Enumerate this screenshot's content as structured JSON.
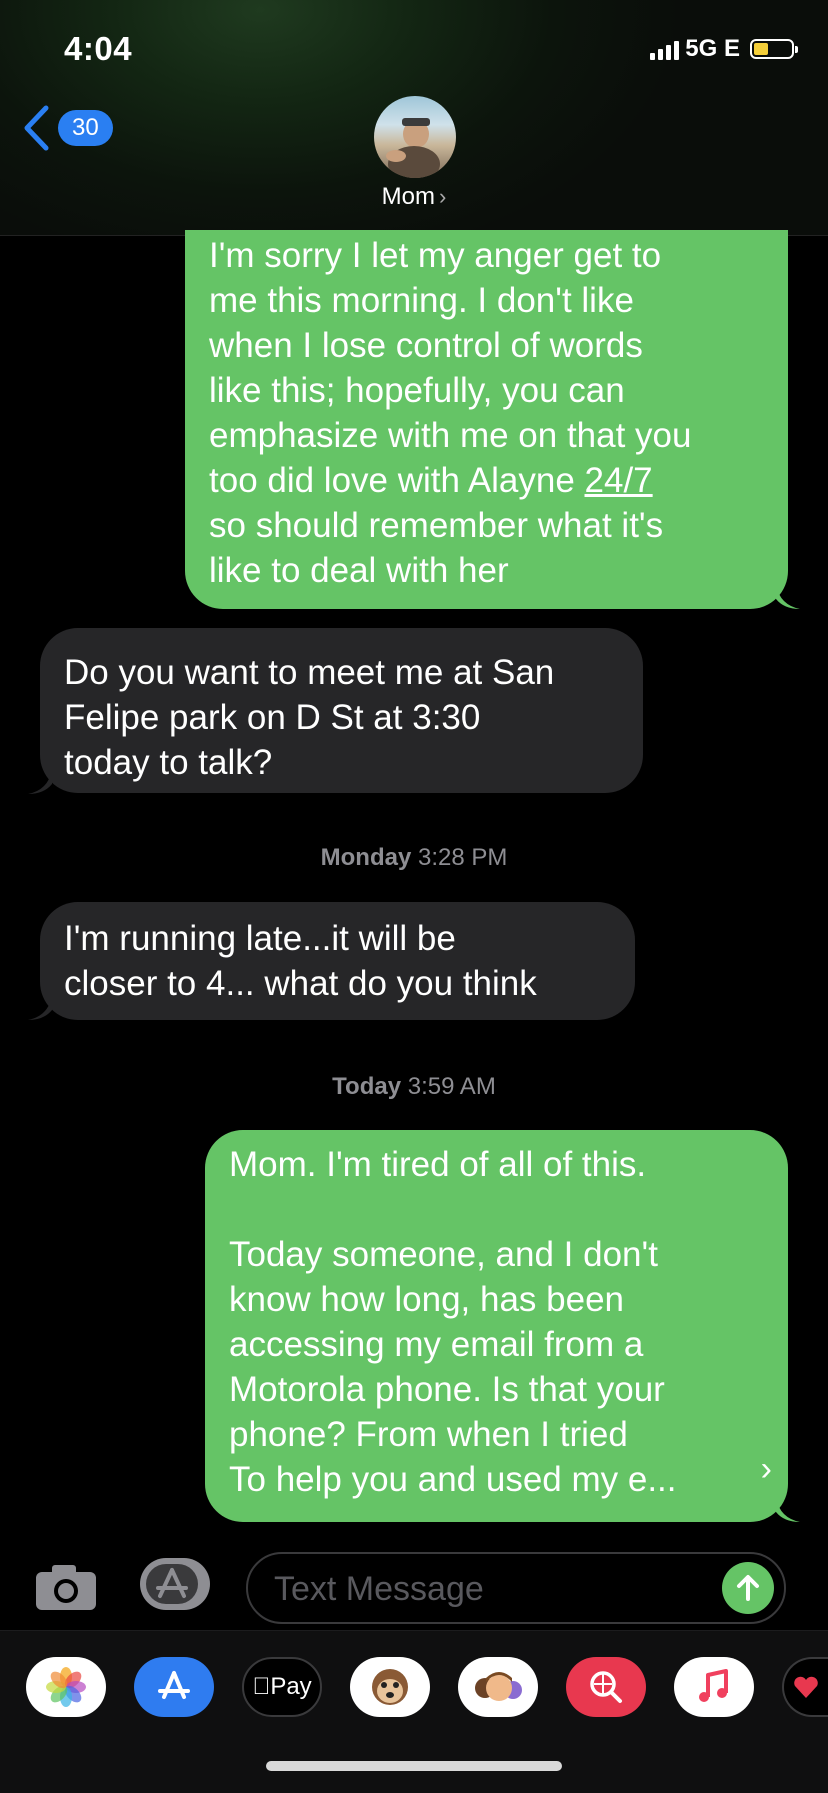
{
  "status_bar": {
    "time": "4:04",
    "network": "5G E"
  },
  "header": {
    "back_count": "30",
    "contact_name": "Mom"
  },
  "messages": [
    {
      "type": "sent",
      "text": "I'm sorry I let my anger get to\nme this morning. I don't like\nwhen I lose control of words\nlike this; hopefully, you can\nemphasize with me on that you\ntoo did love with Alayne ",
      "link": "24/7",
      "text_after": "\nso should remember what it's\nlike to deal with her"
    },
    {
      "type": "received",
      "text": "Do you want to meet me at San\nFelipe park on D St at 3:30\ntoday to talk?"
    },
    {
      "type": "received",
      "text": "I'm running late...it will be\ncloser to 4... what do you think"
    },
    {
      "type": "sent",
      "text": "Mom. I'm tired of all of this.\n\nToday someone, and I don't\nknow how long, has been\naccessing my email from a\nMotorola phone. Is that your\nphone? From when I tried\nTo help you and used my e..."
    }
  ],
  "timestamps": [
    {
      "day": "Monday",
      "time": "3:28 PM"
    },
    {
      "day": "Today",
      "time": "3:59 AM"
    }
  ],
  "input": {
    "placeholder": "Text Message"
  },
  "app_drawer": [
    {
      "name": "photos-icon"
    },
    {
      "name": "app-store-icon"
    },
    {
      "name": "apple-pay-icon",
      "label": "Pay"
    },
    {
      "name": "animoji-icon"
    },
    {
      "name": "memoji-icon"
    },
    {
      "name": "web-search-icon"
    },
    {
      "name": "music-icon"
    },
    {
      "name": "digital-touch-icon"
    }
  ],
  "colors": {
    "sent": "#65c466",
    "received": "#262628",
    "accent": "#2a7ff2"
  }
}
